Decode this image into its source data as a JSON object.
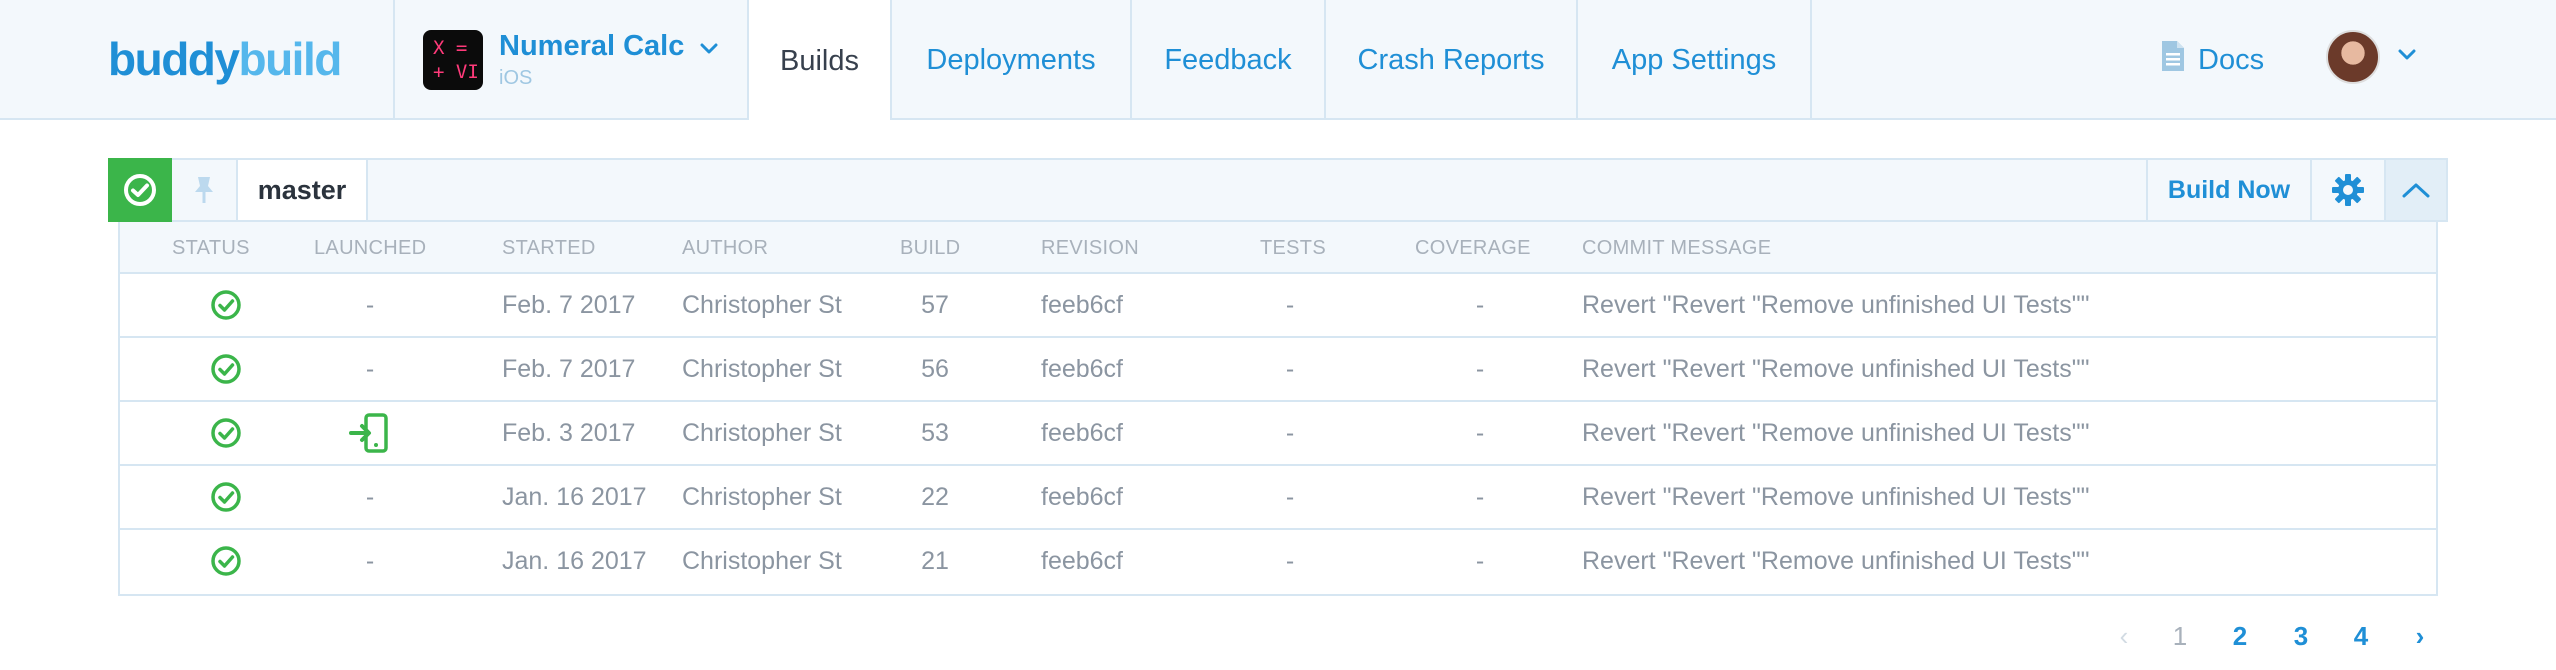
{
  "header": {
    "logo": {
      "part1": "buddy",
      "part2": "build"
    },
    "app": {
      "name": "Numeral Calc",
      "platform": "iOS",
      "icon_text_line1": "X =",
      "icon_text_line2": "+ VI"
    },
    "tabs": [
      {
        "label": "Builds",
        "active": true
      },
      {
        "label": "Deployments",
        "active": false
      },
      {
        "label": "Feedback",
        "active": false
      },
      {
        "label": "Crash Reports",
        "active": false
      },
      {
        "label": "App Settings",
        "active": false
      }
    ],
    "docs_label": "Docs"
  },
  "branch_bar": {
    "status": "success",
    "branch": "master",
    "build_now_label": "Build Now"
  },
  "table": {
    "columns": [
      "STATUS",
      "LAUNCHED",
      "STARTED",
      "AUTHOR",
      "BUILD",
      "REVISION",
      "TESTS",
      "COVERAGE",
      "COMMIT MESSAGE"
    ],
    "rows": [
      {
        "status": "success",
        "launched": "-",
        "started": "Feb. 7 2017",
        "author": "Christopher St",
        "build": "57",
        "revision": "feeb6cf",
        "tests": "-",
        "coverage": "-",
        "message": "Revert \"Revert \"Remove unfinished UI Tests\"\""
      },
      {
        "status": "success",
        "launched": "-",
        "started": "Feb. 7 2017",
        "author": "Christopher St",
        "build": "56",
        "revision": "feeb6cf",
        "tests": "-",
        "coverage": "-",
        "message": "Revert \"Revert \"Remove unfinished UI Tests\"\""
      },
      {
        "status": "success",
        "launched": "device",
        "started": "Feb. 3 2017",
        "author": "Christopher St",
        "build": "53",
        "revision": "feeb6cf",
        "tests": "-",
        "coverage": "-",
        "message": "Revert \"Revert \"Remove unfinished UI Tests\"\""
      },
      {
        "status": "success",
        "launched": "-",
        "started": "Jan. 16 2017",
        "author": "Christopher St",
        "build": "22",
        "revision": "feeb6cf",
        "tests": "-",
        "coverage": "-",
        "message": "Revert \"Revert \"Remove unfinished UI Tests\"\""
      },
      {
        "status": "success",
        "launched": "-",
        "started": "Jan. 16 2017",
        "author": "Christopher St",
        "build": "21",
        "revision": "feeb6cf",
        "tests": "-",
        "coverage": "-",
        "message": "Revert \"Revert \"Remove unfinished UI Tests\"\""
      }
    ]
  },
  "pagination": {
    "prev": "‹",
    "pages": [
      "1",
      "2",
      "3",
      "4"
    ],
    "current": "1",
    "next": "›"
  },
  "colors": {
    "accent": "#1f8fd6",
    "success": "#3bb54a",
    "header_bg": "#f3f8fc",
    "border": "#d6e6f2",
    "muted_text": "#8b95a1"
  }
}
